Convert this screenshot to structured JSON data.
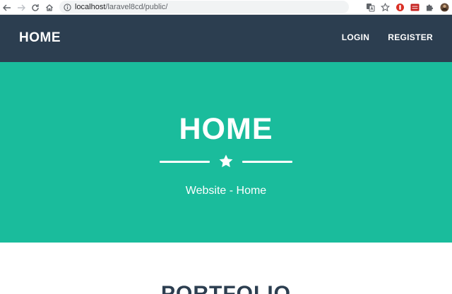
{
  "browser": {
    "url_host": "localhost",
    "url_path": "/laravel8cd/public/",
    "icons": [
      "back-arrow-icon",
      "forward-arrow-icon",
      "reload-icon",
      "home-icon",
      "info-icon",
      "translate-icon",
      "bookmark-star-icon",
      "extension-red-icon",
      "extension-badge-icon",
      "puzzle-icon",
      "profile-avatar-icon"
    ]
  },
  "navbar": {
    "brand": "HOME",
    "links": [
      {
        "label": "LOGIN"
      },
      {
        "label": "REGISTER"
      }
    ],
    "background": "#2c3e50"
  },
  "masthead": {
    "title": "HOME",
    "subtitle": "Website - Home",
    "background": "#1abc9c",
    "divider_icon": "star-icon"
  },
  "portfolio": {
    "heading": "PORTFOLIO",
    "heading_color": "#2c3e50"
  }
}
